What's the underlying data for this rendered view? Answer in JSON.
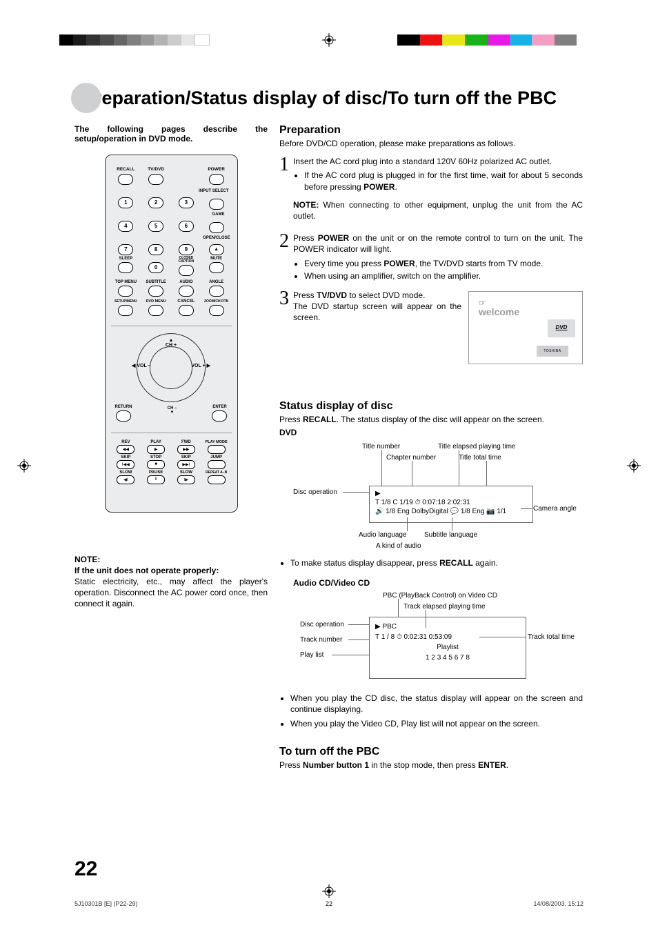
{
  "title": "Preparation/Status display of disc/To turn off the PBC",
  "intro": "The following pages describe the setup/operation in DVD mode.",
  "note": {
    "heading": "NOTE:",
    "bold": "If the unit does not operate properly:",
    "body": "Static electricity, etc., may affect the player's operation. Disconnect the AC power cord once, then connect it again."
  },
  "remote": {
    "row1": [
      "RECALL",
      "TV/DVD",
      "",
      "POWER"
    ],
    "row_input": "INPUT SELECT",
    "row_game": "GAME",
    "row_open": "OPEN/CLOSE",
    "row_sleep": "SLEEP",
    "row_cc": "CLOSED CAPTION",
    "row_mute": "MUTE",
    "row_menu": [
      "TOP MENU",
      "SUBTITLE",
      "AUDIO",
      "ANGLE"
    ],
    "row_setup": [
      "SETUP/MENU",
      "DVD MENU",
      "CANCEL",
      "ZOOM/CH RTN"
    ],
    "nav": {
      "up": "CH +",
      "down": "CH –",
      "left": "VOL –",
      "right": "VOL +",
      "bl": "RETURN",
      "br": "ENTER"
    },
    "play": {
      "r1": [
        "REV",
        "PLAY",
        "FWD",
        "PLAY MODE"
      ],
      "r2": [
        "SKIP",
        "STOP",
        "SKIP",
        "JUMP"
      ],
      "r3": [
        "SLOW",
        "PAUSE",
        "SLOW",
        "REPEAT A–B"
      ],
      "icons": {
        "rev": "◀◀",
        "play": "▶",
        "fwd": "▶▶",
        "skipb": "I◀◀",
        "stop": "■",
        "skipf": "▶▶I",
        "slowb": "◀I",
        "pause": "II",
        "slowf": "I▶"
      }
    }
  },
  "prep": {
    "heading": "Preparation",
    "lead": "Before DVD/CD operation, please make preparations as follows.",
    "step1": {
      "p": "Insert the AC cord plug into a standard 120V 60Hz polarized AC outlet.",
      "li": "If the AC cord plug is plugged in for the first time, wait for about 5 seconds before pressing ",
      "li_b": "POWER",
      "li_end": "."
    },
    "note_inline_label": "NOTE:",
    "note_inline": " When connecting to other equipment, unplug the unit from the AC outlet.",
    "step2": {
      "p1a": "Press ",
      "p1b": "POWER",
      "p1c": " on the unit or on the remote control to turn on the unit. The POWER indicator will light.",
      "li1a": "Every time you press ",
      "li1b": "POWER",
      "li1c": ", the TV/DVD starts from TV mode.",
      "li2": "When using an amplifier, switch on the amplifier."
    },
    "step3": {
      "p1a": "Press ",
      "p1b": "TV/DVD",
      "p1c": " to select DVD mode.",
      "p2": "The DVD startup screen will appear on the screen."
    },
    "welcome": {
      "text": "welcome",
      "dvd": "DVD",
      "brand": "TOSHIBA"
    }
  },
  "status": {
    "heading": "Status display of disc",
    "p1a": "Press ",
    "p1b": "RECALL",
    "p1c": ". The status display of the disc will appear on the screen.",
    "dvd_label": "DVD",
    "dvd_anno": {
      "title_num": "Title number",
      "chapter_num": "Chapter number",
      "elapsed": "Title elapsed playing time",
      "total": "Title total time",
      "disc_op": "Disc operation",
      "camera": "Camera angle",
      "audio_lang": "Audio language",
      "subtitle": "Subtitle language",
      "kind": "A kind of audio"
    },
    "dvd_box": {
      "l1": "▶",
      "l2": "T 1/8   C 1/19   ⏱ 0:07:18  2:02:31",
      "l3": "🔊 1/8 Eng DolbyDigital  💬 1/8 Eng 📷 1/1"
    },
    "bullet1a": "To make status display disappear, press ",
    "bullet1b": "RECALL",
    "bullet1c": " again.",
    "cd_label": "Audio CD/Video CD",
    "cd_anno": {
      "pbc": "PBC (PlayBack Control) on Video CD",
      "elapsed": "Track elapsed playing time",
      "total": "Track total time",
      "disc_op": "Disc operation",
      "track_num": "Track number",
      "playlist": "Play list"
    },
    "cd_box": {
      "l1": "▶  PBC",
      "l2": "T 1 / 8   ⏱ 0:02:31  0:53:09",
      "l3": "Playlist",
      "l4": "1  2  3  4  5  6  7  8"
    },
    "cd_bullets": [
      "When you play the CD disc, the status display will appear on the screen and continue displaying.",
      "When you play the Video CD, Play list will not appear on the screen."
    ]
  },
  "pbc": {
    "heading": "To turn off the PBC",
    "p1a": "Press ",
    "p1b": "Number button 1",
    "p1c": " in the stop mode, then press ",
    "p1d": "ENTER",
    "p1e": "."
  },
  "page_number": "22",
  "footer": {
    "left": "5J10301B [E] (P22-29)",
    "mid": "22",
    "right": "14/08/2003, 15:12"
  }
}
